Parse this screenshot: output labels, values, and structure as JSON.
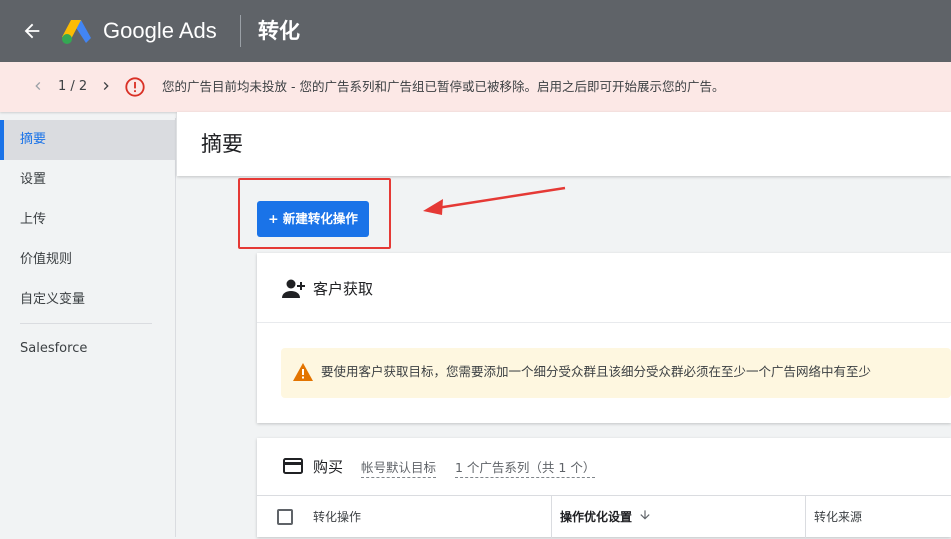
{
  "header": {
    "brand": "Google Ads",
    "page_title": "转化",
    "colors": {
      "bar": "#5f6368",
      "logo_blue": "#4285f4",
      "logo_yellow": "#fbbc04",
      "logo_green": "#34a853"
    }
  },
  "alert": {
    "count": "1 / 2",
    "message": "您的广告目前均未投放 - 您的广告系列和广告组已暂停或已被移除。启用之后即可开始展示您的广告。",
    "icon": "error-icon",
    "color": "#d93025"
  },
  "sidebar": {
    "items": [
      {
        "label": "摘要",
        "active": true
      },
      {
        "label": "设置"
      },
      {
        "label": "上传"
      },
      {
        "label": "价值规则"
      },
      {
        "label": "自定义变量"
      },
      {
        "label": "Salesforce"
      }
    ]
  },
  "main": {
    "title": "摘要",
    "new_button": "+ 新建转化操作",
    "accent": "#1a73e8",
    "annotation_color": "#e53935"
  },
  "customer_card": {
    "title": "客户获取",
    "icon": "person-add-icon",
    "warning": "要使用客户获取目标，您需要添加一个细分受众群且该细分受众群必须在至少一个广告网络中有至少"
  },
  "purchase_card": {
    "title": "购买",
    "icon": "credit-card-icon",
    "link_default": "帐号默认目标",
    "link_campaigns": "1 个广告系列（共 1 个）",
    "columns": [
      "转化操作",
      "操作优化设置",
      "转化来源"
    ]
  }
}
